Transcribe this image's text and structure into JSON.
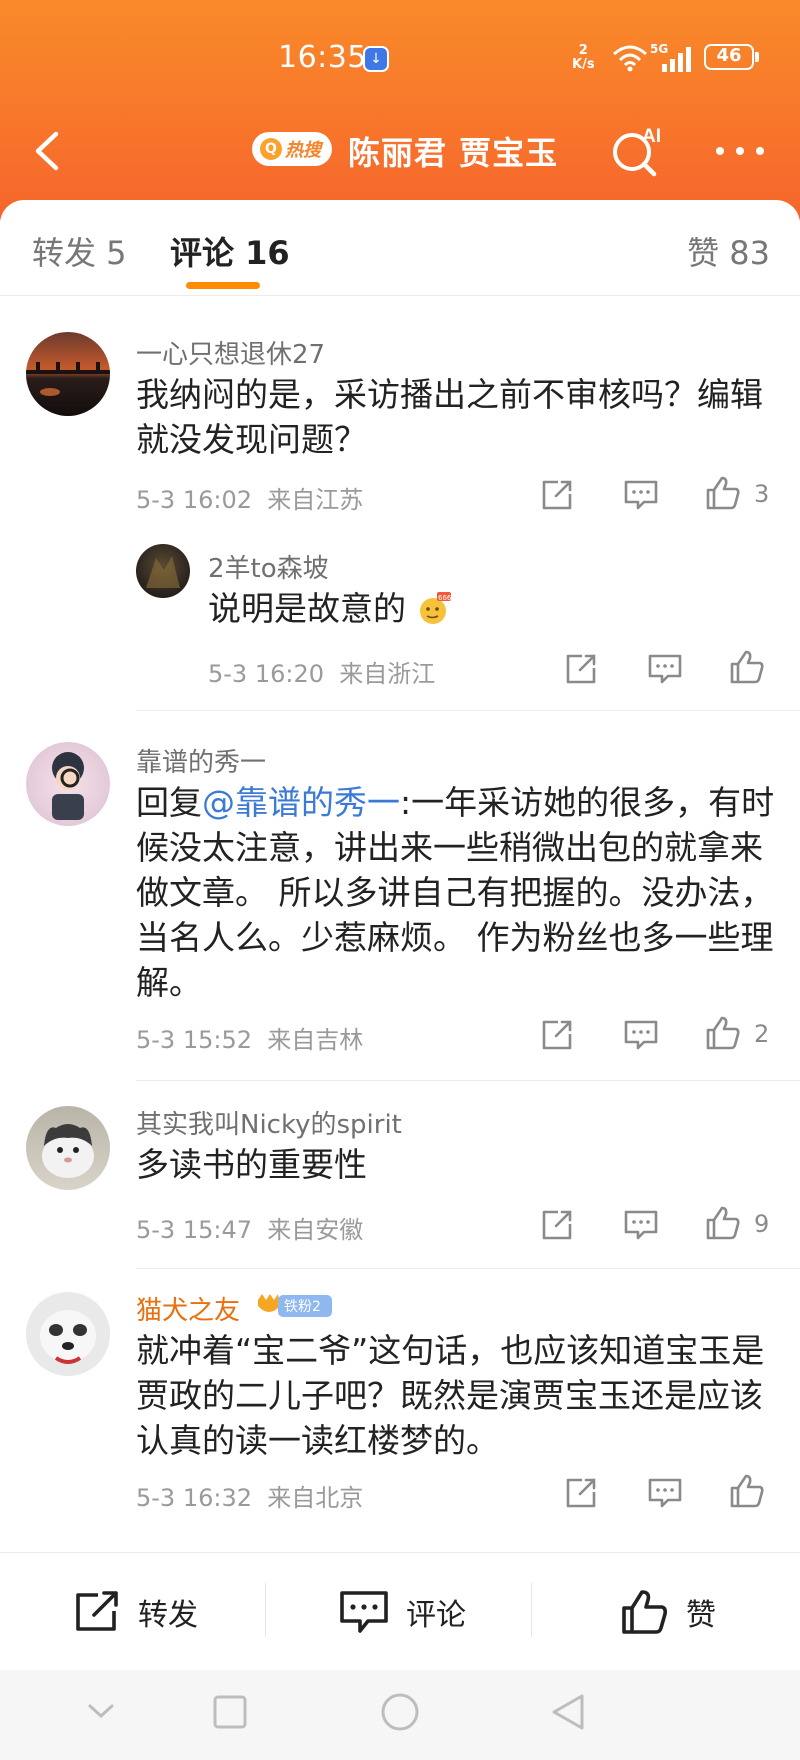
{
  "status_bar": {
    "time": "16:35",
    "net_speed_top": "2",
    "net_speed_unit": "K/s",
    "network": "5G",
    "battery": "46"
  },
  "nav": {
    "hot_badge": "热搜",
    "title": "陈丽君 贾宝玉",
    "ai_label": "AI"
  },
  "tabs": {
    "repost": "转发 5",
    "comment": "评论 16",
    "like": "赞 83"
  },
  "comments": [
    {
      "user": "一心只想退休27",
      "text": "我纳闷的是，采访播出之前不审核吗？编辑就没发现问题？",
      "time": "5-3 16:02",
      "location": "来自江苏",
      "likes": "3"
    },
    {
      "user": "2羊to森坡",
      "text": "说明是故意的",
      "emoji": "666",
      "time": "5-3 16:20",
      "location": "来自浙江",
      "likes": ""
    },
    {
      "user": "靠谱的秀一",
      "reply_prefix": "回复",
      "mention": "@靠谱的秀一",
      "text": ":一年采访她的很多，有时候没太注意，讲出来一些稍微出包的就拿来做文章。 所以多讲自己有把握的。没办法，当名人么。少惹麻烦。 作为粉丝也多一些理解。",
      "time": "5-3 15:52",
      "location": "来自吉林",
      "likes": "2"
    },
    {
      "user": "其实我叫Nicky的spirit",
      "text": "多读书的重要性",
      "time": "5-3 15:47",
      "location": "来自安徽",
      "likes": "9"
    },
    {
      "user": "猫犬之友",
      "badge": "铁粉2",
      "text": "就冲着“宝二爷”这句话，也应该知道宝玉是贾政的二儿子吧？既然是演贾宝玉还是应该认真的读一读红楼梦的。",
      "time": "5-3 16:32",
      "location": "来自北京",
      "likes": ""
    }
  ],
  "bottom_bar": {
    "repost": "转发",
    "comment": "评论",
    "like": "赞"
  },
  "colors": {
    "header_orange": "#f87a2b",
    "tab_indicator": "#ff8c00",
    "mention_blue": "#3b7ad6",
    "vip_name": "#e8700f"
  }
}
